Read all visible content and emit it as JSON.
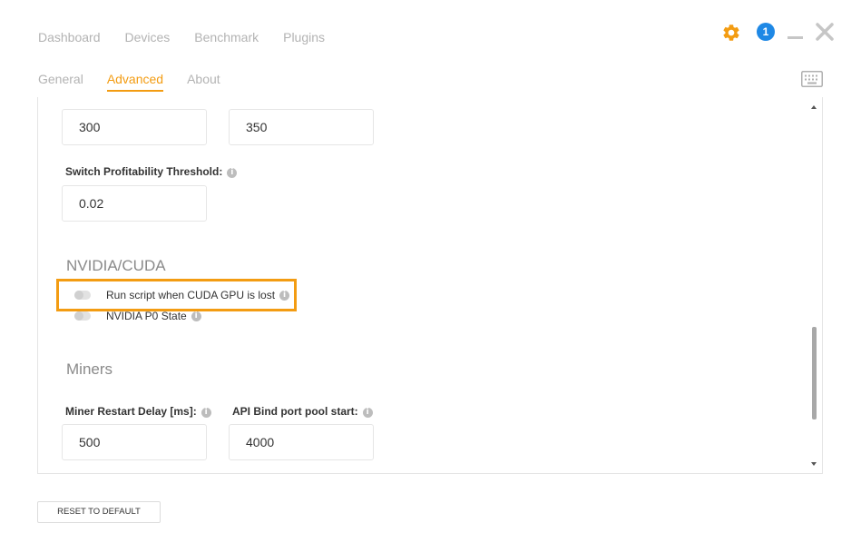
{
  "top_nav": [
    "Dashboard",
    "Devices",
    "Benchmark",
    "Plugins"
  ],
  "notification_count": "1",
  "sub_nav": {
    "tabs": [
      "General",
      "Advanced",
      "About"
    ],
    "active": "Advanced"
  },
  "switching": {
    "min_value": "300",
    "max_value": "350",
    "threshold_label": "Switch Profitability Threshold:",
    "threshold_value": "0.02"
  },
  "nvidia": {
    "title": "NVIDIA/CUDA",
    "toggles": [
      {
        "label": "Run script when CUDA GPU is lost",
        "enabled": false
      },
      {
        "label": "NVIDIA P0 State",
        "enabled": false
      }
    ]
  },
  "miners": {
    "title": "Miners",
    "restart_delay_label": "Miner Restart Delay [ms]:",
    "restart_delay_value": "500",
    "api_port_label": "API Bind port pool start:",
    "api_port_value": "4000"
  },
  "reset_button": "RESET TO DEFAULT",
  "colors": {
    "accent": "#f39c12",
    "badge": "#1e88e5",
    "muted": "#b3b3b3"
  },
  "icons": [
    "gear-icon",
    "notification-badge",
    "minimize-icon",
    "close-icon",
    "keyboard-icon",
    "info-icon"
  ]
}
